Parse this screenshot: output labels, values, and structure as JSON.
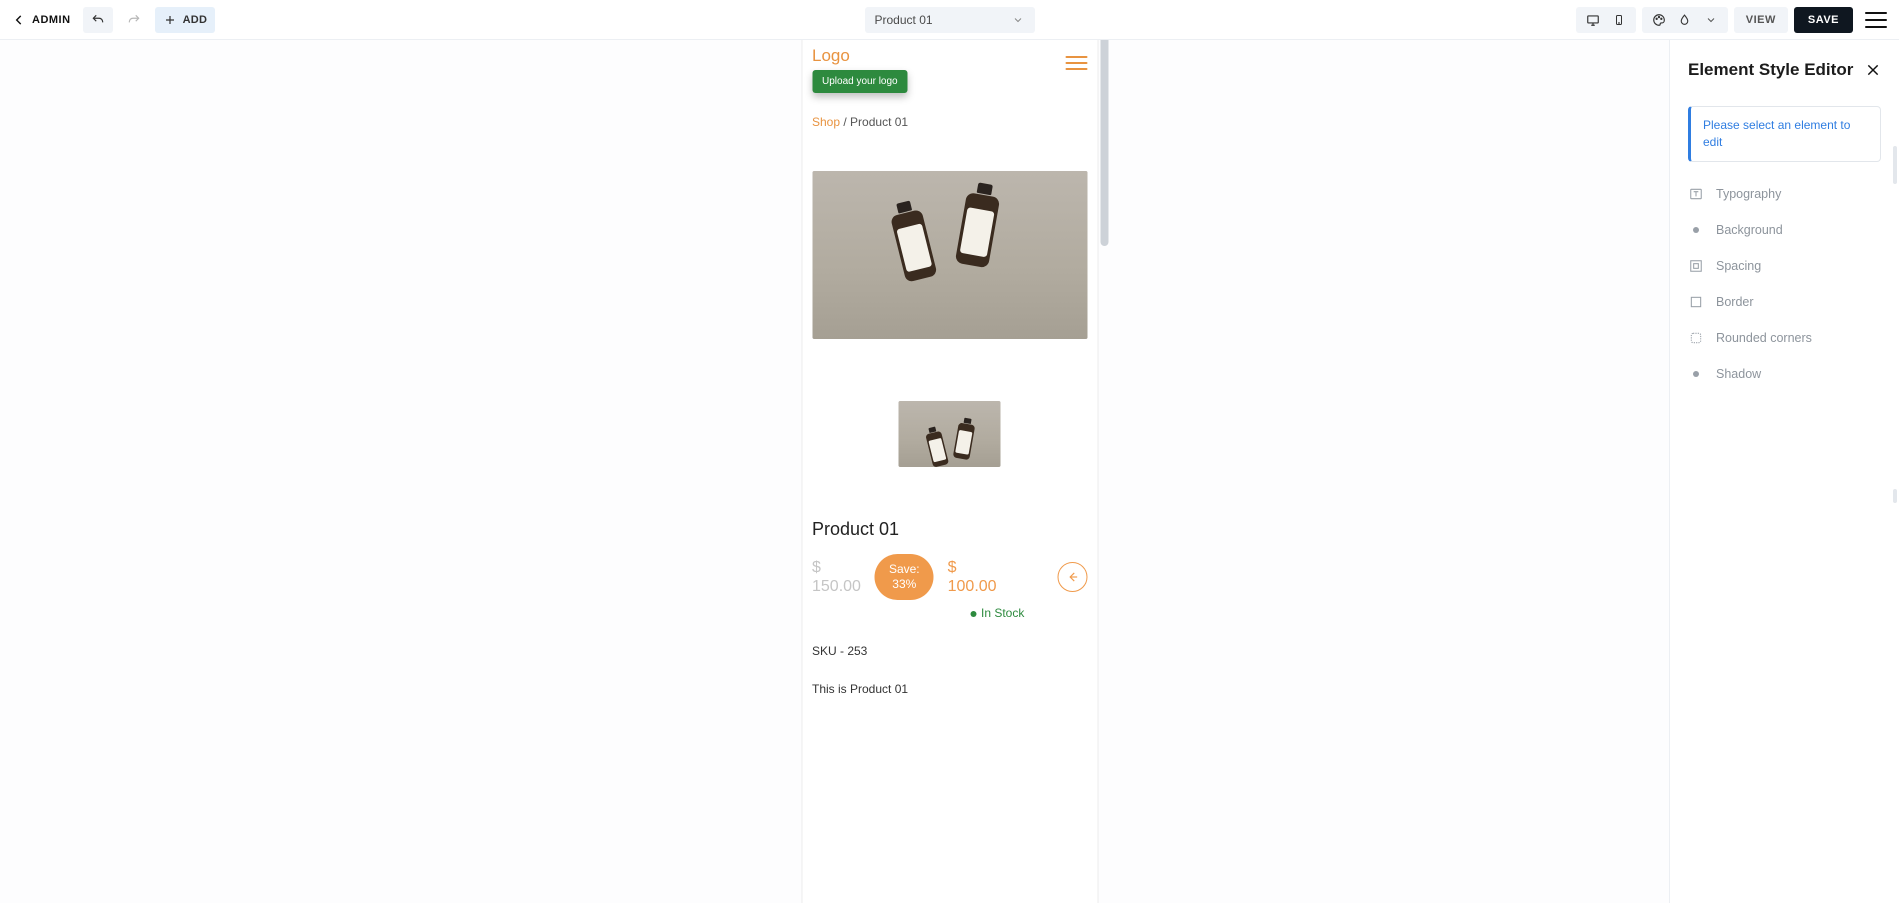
{
  "topbar": {
    "admin_label": "ADMIN",
    "add_label": "ADD",
    "page_selected": "Product 01",
    "view_label": "VIEW",
    "save_label": "SAVE"
  },
  "canvas": {
    "logo_text": "Logo",
    "upload_logo_label": "Upload your logo",
    "breadcrumb_shop": "Shop",
    "breadcrumb_sep": " / ",
    "breadcrumb_current": "Product 01",
    "product_title": "Product 01",
    "old_currency": "$",
    "old_price": "150.00",
    "save_label": "Save:",
    "save_pct": "33%",
    "new_currency": "$",
    "new_price": "100.00",
    "instock_label": "In Stock",
    "sku_label": "SKU - 253",
    "description": "This is Product 01"
  },
  "panel": {
    "title": "Element Style Editor",
    "notice": "Please select an element to edit",
    "props": {
      "typography": "Typography",
      "background": "Background",
      "spacing": "Spacing",
      "border": "Border",
      "rounded": "Rounded corners",
      "shadow": "Shadow"
    }
  }
}
